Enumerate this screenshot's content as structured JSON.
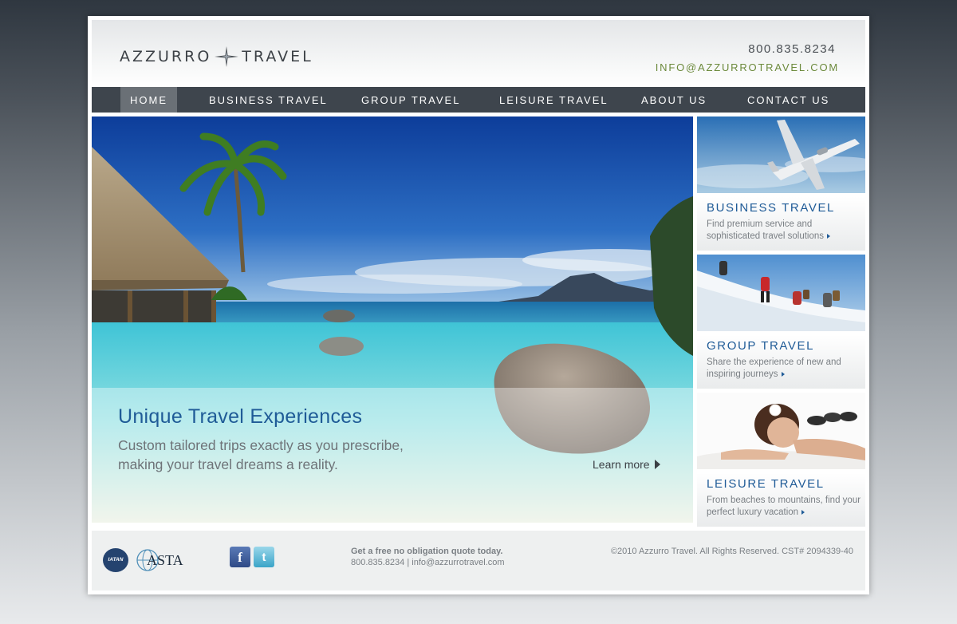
{
  "brand": {
    "left": "AZZURRO",
    "right": "TRAVEL"
  },
  "contact": {
    "phone": "800.835.8234",
    "email": "INFO@AZZURROTRAVEL.COM"
  },
  "nav": {
    "items": [
      {
        "label": "HOME",
        "active": true
      },
      {
        "label": "BUSINESS TRAVEL",
        "active": false
      },
      {
        "label": "GROUP TRAVEL",
        "active": false
      },
      {
        "label": "LEISURE TRAVEL",
        "active": false
      },
      {
        "label": "ABOUT US",
        "active": false
      },
      {
        "label": "CONTACT US",
        "active": false
      }
    ]
  },
  "hero": {
    "headline": "Unique Travel Experiences",
    "line1": "Custom tailored trips exactly as you prescribe,",
    "line2": "making your travel dreams a reality.",
    "cta": "Learn more"
  },
  "cards": [
    {
      "title": "BUSINESS TRAVEL",
      "desc": "Find premium service and sophisticated travel solutions"
    },
    {
      "title": "GROUP TRAVEL",
      "desc": "Share the experience of new and inspiring journeys"
    },
    {
      "title": "LEISURE TRAVEL",
      "desc": "From beaches to mountains, find your perfect luxury vacation"
    }
  ],
  "footer": {
    "iatan": "IATAN",
    "asta": "ASTA",
    "facebook": "f",
    "twitter": "t",
    "quote_title": "Get a free no obligation quote today.",
    "quote_contact": "800.835.8234 | info@azzurrotravel.com",
    "copyright": "©2010 Azzurro Travel. All Rights Reserved. CST# 2094339-40"
  },
  "colors": {
    "accent_blue": "#1f5b97",
    "email_green": "#6c8a3c",
    "nav_bg": "#3e454d"
  },
  "icons": [
    "compass-star-icon",
    "chevron-right-icon",
    "facebook-icon",
    "twitter-icon"
  ]
}
